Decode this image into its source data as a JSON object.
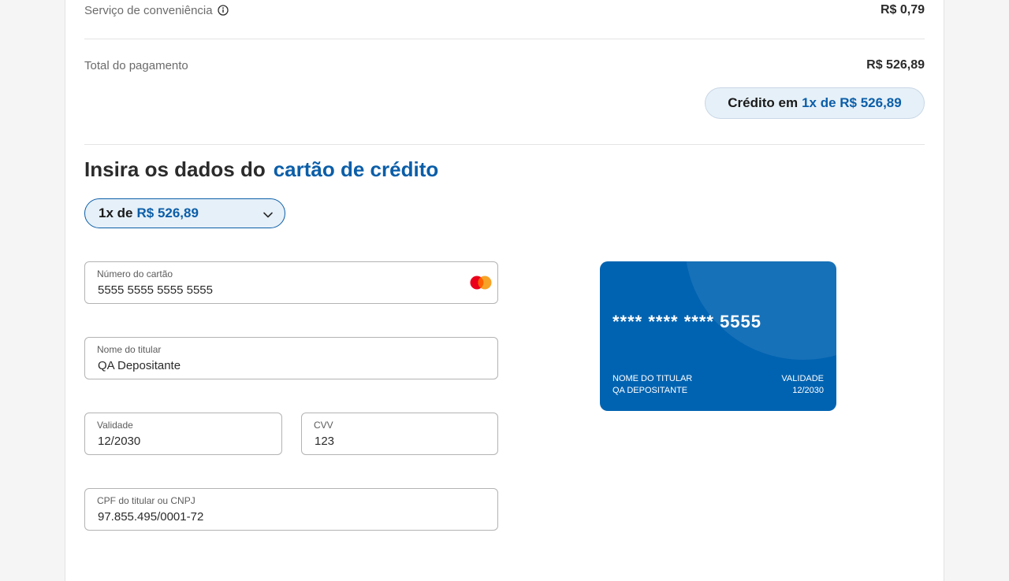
{
  "summary": {
    "service_fee_label": "Serviço de conveniência",
    "service_fee_value": "R$ 0,79",
    "total_label": "Total do pagamento",
    "total_value": "R$ 526,89"
  },
  "credit_pill": {
    "prefix": "Crédito em",
    "highlight": "1x de R$ 526,89"
  },
  "section": {
    "title_prefix": "Insira os dados do",
    "title_highlight": "cartão de crédito"
  },
  "installments": {
    "prefix": "1x de",
    "amount": "R$ 526,89"
  },
  "form": {
    "card_number_label": "Número do cartão",
    "card_number_value": "5555 5555 5555 5555",
    "holder_label": "Nome do titular",
    "holder_value": "QA Depositante",
    "expiry_label": "Validade",
    "expiry_value": "12/2030",
    "cvv_label": "CVV",
    "cvv_value": "123",
    "doc_label": "CPF do titular ou CNPJ",
    "doc_value": "97.855.495/0001-72"
  },
  "card_preview": {
    "masked_number": "**** **** **** 5555",
    "holder_label": "NOME DO TITULAR",
    "holder_value": "QA DEPOSITANTE",
    "expiry_label": "VALIDADE",
    "expiry_value": "12/2030"
  },
  "icons": {
    "info": "info-icon",
    "chevron": "chevron-down-icon",
    "brand": "mastercard-icon"
  },
  "colors": {
    "accent": "#0b5ea8",
    "card_bg": "#0063b1",
    "pill_bg": "#e6f0f8"
  }
}
